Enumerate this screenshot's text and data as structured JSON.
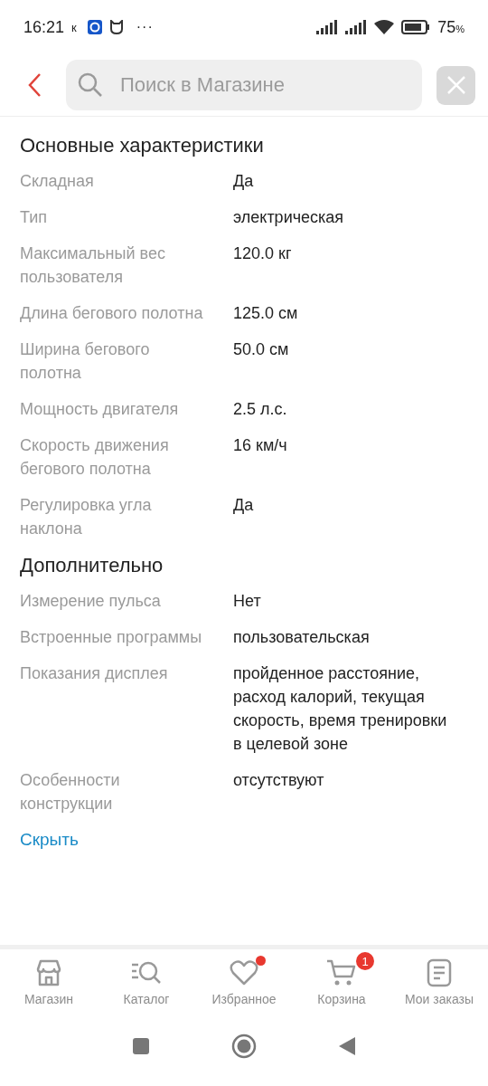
{
  "status_bar": {
    "time": "16:21",
    "carrier_mark": "к",
    "more": "···",
    "battery": "75",
    "battery_unit": "%"
  },
  "search": {
    "placeholder": "Поиск в Магазине"
  },
  "sections": [
    {
      "title": "Основные характеристики",
      "rows": [
        {
          "label": "Складная",
          "value": "Да"
        },
        {
          "label": "Тип",
          "value": "электрическая"
        },
        {
          "label": "Максимальный вес пользователя",
          "value": "120.0 кг"
        },
        {
          "label": "Длина бегового полотна",
          "value": "125.0 см"
        },
        {
          "label": "Ширина бегового полотна",
          "value": "50.0 см"
        },
        {
          "label": "Мощность двигателя",
          "value": "2.5 л.с."
        },
        {
          "label": "Скорость движения бегового полотна",
          "value": "16 км/ч"
        },
        {
          "label": "Регулировка угла наклона",
          "value": "Да"
        }
      ]
    },
    {
      "title": "Дополнительно",
      "rows": [
        {
          "label": "Измерение пульса",
          "value": "Нет"
        },
        {
          "label": "Встроенные программы",
          "value": "пользовательская"
        },
        {
          "label": "Показания дисплея",
          "value": "пройденное расстояние, расход калорий, текущая скорость, время тренировки в целевой зоне"
        },
        {
          "label": "Особенности конструкции",
          "value": "отсутствуют"
        }
      ]
    }
  ],
  "collapse_link": "Скрыть",
  "bottom_nav": [
    {
      "kind": "store",
      "label": "Магазин"
    },
    {
      "kind": "catalog",
      "label": "Каталог"
    },
    {
      "kind": "favorites",
      "label": "Избранное",
      "dot": true
    },
    {
      "kind": "cart",
      "label": "Корзина",
      "badge": "1"
    },
    {
      "kind": "orders",
      "label": "Мои заказы"
    }
  ]
}
